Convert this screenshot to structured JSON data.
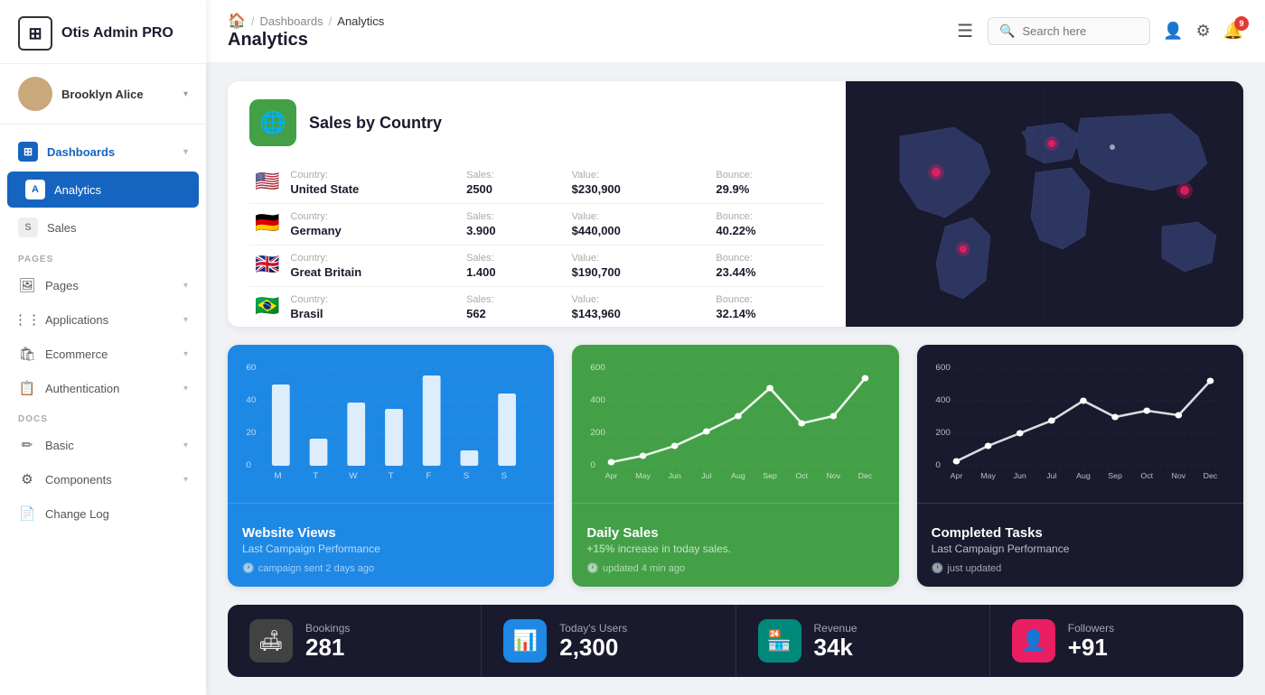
{
  "app": {
    "name": "Otis Admin PRO"
  },
  "user": {
    "name": "Brooklyn Alice"
  },
  "sidebar": {
    "section_pages": "PAGES",
    "section_docs": "DOCS",
    "items": [
      {
        "id": "dashboards",
        "label": "Dashboards",
        "icon": "⊞",
        "active": false,
        "parent": true,
        "open": true
      },
      {
        "id": "analytics",
        "label": "Analytics",
        "icon": "A",
        "active": true
      },
      {
        "id": "sales",
        "label": "Sales",
        "icon": "S",
        "active": false
      },
      {
        "id": "pages",
        "label": "Pages",
        "icon": "🖼",
        "active": false
      },
      {
        "id": "applications",
        "label": "Applications",
        "icon": "⋮⋮",
        "active": false
      },
      {
        "id": "ecommerce",
        "label": "Ecommerce",
        "icon": "🛍",
        "active": false
      },
      {
        "id": "authentication",
        "label": "Authentication",
        "icon": "📋",
        "active": false
      },
      {
        "id": "basic",
        "label": "Basic",
        "icon": "✏",
        "active": false
      },
      {
        "id": "components",
        "label": "Components",
        "icon": "⚙",
        "active": false
      },
      {
        "id": "changelog",
        "label": "Change Log",
        "icon": "📄",
        "active": false
      }
    ]
  },
  "header": {
    "home_icon": "🏠",
    "breadcrumb_sep1": "/",
    "breadcrumb_dashboards": "Dashboards",
    "breadcrumb_sep2": "/",
    "breadcrumb_current": "Analytics",
    "title": "Analytics",
    "search_placeholder": "Search here"
  },
  "topbar": {
    "notif_count": "9"
  },
  "sales_by_country": {
    "title": "Sales by Country",
    "countries": [
      {
        "flag": "🇺🇸",
        "country_label": "Country:",
        "country": "United State",
        "sales_label": "Sales:",
        "sales": "2500",
        "value_label": "Value:",
        "value": "$230,900",
        "bounce_label": "Bounce:",
        "bounce": "29.9%"
      },
      {
        "flag": "🇩🇪",
        "country_label": "Country:",
        "country": "Germany",
        "sales_label": "Sales:",
        "sales": "3.900",
        "value_label": "Value:",
        "value": "$440,000",
        "bounce_label": "Bounce:",
        "bounce": "40.22%"
      },
      {
        "flag": "🇬🇧",
        "country_label": "Country:",
        "country": "Great Britain",
        "sales_label": "Sales:",
        "sales": "1.400",
        "value_label": "Value:",
        "value": "$190,700",
        "bounce_label": "Bounce:",
        "bounce": "23.44%"
      },
      {
        "flag": "🇧🇷",
        "country_label": "Country:",
        "country": "Brasil",
        "sales_label": "Sales:",
        "sales": "562",
        "value_label": "Value:",
        "value": "$143,960",
        "bounce_label": "Bounce:",
        "bounce": "32.14%"
      }
    ]
  },
  "chart_website_views": {
    "title": "Website Views",
    "subtitle": "Last Campaign Performance",
    "meta": "campaign sent 2 days ago",
    "y_labels": [
      "60",
      "40",
      "20",
      "0"
    ],
    "x_labels": [
      "M",
      "T",
      "W",
      "T",
      "F",
      "S",
      "S"
    ],
    "bars": [
      55,
      18,
      42,
      38,
      60,
      10,
      48
    ]
  },
  "chart_daily_sales": {
    "title": "Daily Sales",
    "subtitle": "(+15%) increase in today sales.",
    "highlight": "+15%",
    "meta": "updated 4 min ago",
    "y_labels": [
      "600",
      "400",
      "200",
      "0"
    ],
    "x_labels": [
      "Apr",
      "May",
      "Jun",
      "Jul",
      "Aug",
      "Sep",
      "Oct",
      "Nov",
      "Dec"
    ],
    "line": [
      20,
      60,
      120,
      220,
      320,
      480,
      260,
      320,
      540
    ]
  },
  "chart_completed_tasks": {
    "title": "Completed Tasks",
    "subtitle": "Last Campaign Performance",
    "meta": "just updated",
    "y_labels": [
      "600",
      "400",
      "200",
      "0"
    ],
    "x_labels": [
      "Apr",
      "May",
      "Jun",
      "Jul",
      "Aug",
      "Sep",
      "Oct",
      "Nov",
      "Dec"
    ],
    "line": [
      30,
      120,
      200,
      280,
      400,
      300,
      340,
      310,
      520
    ]
  },
  "stats": [
    {
      "id": "bookings",
      "icon": "🛋",
      "icon_style": "gray",
      "label": "Bookings",
      "value": "281"
    },
    {
      "id": "users",
      "icon": "📊",
      "icon_style": "blue",
      "label": "Today's Users",
      "value": "2,300"
    },
    {
      "id": "revenue",
      "icon": "🏪",
      "icon_style": "teal",
      "label": "Revenue",
      "value": "34k"
    },
    {
      "id": "followers",
      "icon": "👤",
      "icon_style": "pink",
      "label": "Followers",
      "value": "+91"
    }
  ]
}
